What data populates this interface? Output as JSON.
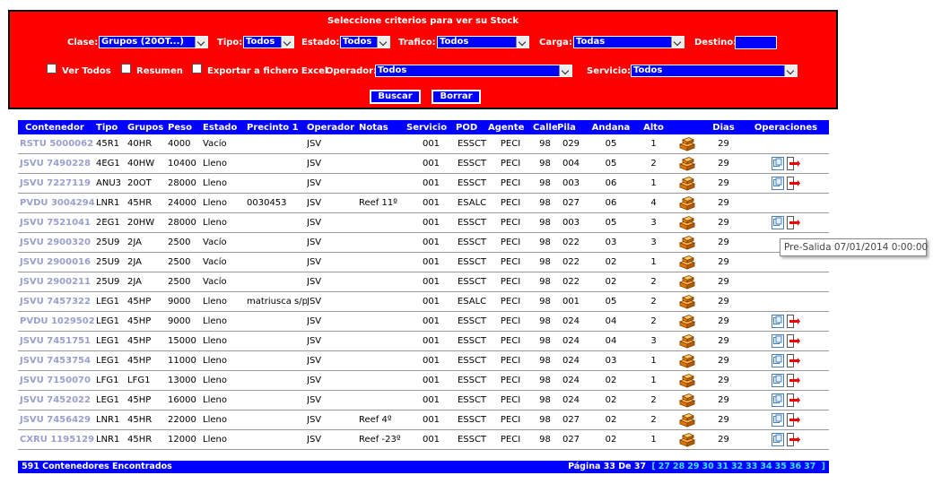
{
  "criteria": {
    "title": "Seleccione criterios para ver su Stock",
    "clase": {
      "label": "Clase:",
      "value": "Grupos (20OT...)"
    },
    "tipo": {
      "label": "Tipo:",
      "value": "Todos"
    },
    "estado": {
      "label": "Estado:",
      "value": "Todos"
    },
    "trafico": {
      "label": "Trafico:",
      "value": "Todos"
    },
    "carga": {
      "label": "Carga:",
      "value": "Todas"
    },
    "destino": {
      "label": "Destino:",
      "value": ""
    },
    "ver_todos": "Ver Todos",
    "resumen": "Resumen",
    "exportar": "Exportar a fichero Excel",
    "operador": {
      "label": "Operador:",
      "value": "Todos"
    },
    "servicio": {
      "label": "Servicio:",
      "value": "Todos"
    },
    "buscar": "Buscar",
    "borrar": "Borrar"
  },
  "table": {
    "headers": [
      "Contenedor",
      "Tipo",
      "Grupos",
      "Peso",
      "Estado",
      "Precinto 1",
      "Operador",
      "Notas",
      "Servicio",
      "POD",
      "Agente",
      "Calle",
      "Pila",
      "Andana",
      "Alto",
      "",
      "Dias",
      "Operaciones"
    ],
    "rows": [
      {
        "c": "RSTU 5000062",
        "t": "45R1",
        "g": "40HR",
        "p": "4000",
        "e": "Vacío",
        "pr": "",
        "o": "JSV",
        "n": "",
        "s": "001",
        "pod": "ESSCT",
        "a": "PECI",
        "ca": "98",
        "pi": "029",
        "an": "05",
        "al": "1",
        "d": "29",
        "ops": false
      },
      {
        "c": "JSVU 7490228",
        "t": "4EG1",
        "g": "40HW",
        "p": "10400",
        "e": "Lleno",
        "pr": "",
        "o": "JSV",
        "n": "",
        "s": "001",
        "pod": "ESSCT",
        "a": "PECI",
        "ca": "98",
        "pi": "004",
        "an": "05",
        "al": "2",
        "d": "29",
        "ops": true
      },
      {
        "c": "JSVU 7227119",
        "t": "ANU3",
        "g": "20OT",
        "p": "28000",
        "e": "Lleno",
        "pr": "",
        "o": "JSV",
        "n": "",
        "s": "001",
        "pod": "ESSCT",
        "a": "PECI",
        "ca": "98",
        "pi": "003",
        "an": "06",
        "al": "1",
        "d": "29",
        "ops": true
      },
      {
        "c": "PVDU 3004294",
        "t": "LNR1",
        "g": "45HR",
        "p": "24000",
        "e": "Lleno",
        "pr": "0030453",
        "o": "JSV",
        "n": "Reef 11º",
        "s": "001",
        "pod": "ESALC",
        "a": "PECI",
        "ca": "98",
        "pi": "027",
        "an": "06",
        "al": "4",
        "d": "29",
        "ops": false
      },
      {
        "c": "JSVU 7521041",
        "t": "2EG1",
        "g": "20HW",
        "p": "28000",
        "e": "Lleno",
        "pr": "",
        "o": "JSV",
        "n": "",
        "s": "001",
        "pod": "ESSCT",
        "a": "PECI",
        "ca": "98",
        "pi": "003",
        "an": "05",
        "al": "3",
        "d": "29",
        "ops": true
      },
      {
        "c": "JSVU 2900320",
        "t": "25U9",
        "g": "2JA",
        "p": "2500",
        "e": "Vacío",
        "pr": "",
        "o": "JSV",
        "n": "",
        "s": "001",
        "pod": "ESSCT",
        "a": "PECI",
        "ca": "98",
        "pi": "022",
        "an": "03",
        "al": "3",
        "d": "29",
        "ops": false
      },
      {
        "c": "JSVU 2900016",
        "t": "25U9",
        "g": "2JA",
        "p": "2500",
        "e": "Vacío",
        "pr": "",
        "o": "JSV",
        "n": "",
        "s": "001",
        "pod": "ESSCT",
        "a": "PECI",
        "ca": "98",
        "pi": "022",
        "an": "02",
        "al": "1",
        "d": "29",
        "ops": false
      },
      {
        "c": "JSVU 2900211",
        "t": "25U9",
        "g": "2JA",
        "p": "2500",
        "e": "Vacío",
        "pr": "",
        "o": "JSV",
        "n": "",
        "s": "001",
        "pod": "ESSCT",
        "a": "PECI",
        "ca": "98",
        "pi": "022",
        "an": "02",
        "al": "2",
        "d": "29",
        "ops": false
      },
      {
        "c": "JSVU 7457322",
        "t": "LEG1",
        "g": "45HP",
        "p": "9000",
        "e": "Lleno",
        "pr": "matriusca s/p",
        "o": "JSV",
        "n": "",
        "s": "001",
        "pod": "ESALC",
        "a": "PECI",
        "ca": "98",
        "pi": "001",
        "an": "05",
        "al": "2",
        "d": "29",
        "ops": false
      },
      {
        "c": "PVDU 1029502",
        "t": "LEG1",
        "g": "45HP",
        "p": "9000",
        "e": "Lleno",
        "pr": "",
        "o": "JSV",
        "n": "",
        "s": "001",
        "pod": "ESSCT",
        "a": "PECI",
        "ca": "98",
        "pi": "024",
        "an": "04",
        "al": "2",
        "d": "29",
        "ops": true
      },
      {
        "c": "JSVU 7451751",
        "t": "LEG1",
        "g": "45HP",
        "p": "15000",
        "e": "Lleno",
        "pr": "",
        "o": "JSV",
        "n": "",
        "s": "001",
        "pod": "ESSCT",
        "a": "PECI",
        "ca": "98",
        "pi": "024",
        "an": "04",
        "al": "3",
        "d": "29",
        "ops": true
      },
      {
        "c": "JSVU 7453754",
        "t": "LEG1",
        "g": "45HP",
        "p": "11000",
        "e": "Lleno",
        "pr": "",
        "o": "JSV",
        "n": "",
        "s": "001",
        "pod": "ESSCT",
        "a": "PECI",
        "ca": "98",
        "pi": "024",
        "an": "03",
        "al": "1",
        "d": "29",
        "ops": true
      },
      {
        "c": "JSVU 7150070",
        "t": "LFG1",
        "g": "LFG1",
        "p": "13000",
        "e": "Lleno",
        "pr": "",
        "o": "JSV",
        "n": "",
        "s": "001",
        "pod": "ESSCT",
        "a": "PECI",
        "ca": "98",
        "pi": "024",
        "an": "02",
        "al": "1",
        "d": "29",
        "ops": true
      },
      {
        "c": "JSVU 7452022",
        "t": "LEG1",
        "g": "45HP",
        "p": "16000",
        "e": "Lleno",
        "pr": "",
        "o": "JSV",
        "n": "",
        "s": "001",
        "pod": "ESSCT",
        "a": "PECI",
        "ca": "98",
        "pi": "024",
        "an": "02",
        "al": "2",
        "d": "29",
        "ops": true
      },
      {
        "c": "JSVU 7456429",
        "t": "LNR1",
        "g": "45HR",
        "p": "22000",
        "e": "Lleno",
        "pr": "",
        "o": "JSV",
        "n": "Reef 4º",
        "s": "001",
        "pod": "ESSCT",
        "a": "PECI",
        "ca": "98",
        "pi": "027",
        "an": "02",
        "al": "2",
        "d": "29",
        "ops": true
      },
      {
        "c": "CXRU 1195129",
        "t": "LNR1",
        "g": "45HR",
        "p": "12000",
        "e": "Lleno",
        "pr": "",
        "o": "JSV",
        "n": "Reef -23º",
        "s": "001",
        "pod": "ESSCT",
        "a": "PECI",
        "ca": "98",
        "pi": "027",
        "an": "02",
        "al": "1",
        "d": "29",
        "ops": true
      }
    ]
  },
  "footer": {
    "found": "591 Contenedores Encontrados",
    "page": "Página 33 De 37",
    "bracket_open": "[",
    "bracket_close": "]",
    "pages": [
      "27",
      "28",
      "29",
      "30",
      "31",
      "32",
      "33",
      "34",
      "35",
      "36",
      "37"
    ]
  },
  "tooltip": "Pre-Salida 07/01/2014 0:00:00",
  "colors": {
    "panel": "#ff0000",
    "accent": "#0000ff",
    "link": "#9aa0cc",
    "page_link": "#40e0ff"
  }
}
